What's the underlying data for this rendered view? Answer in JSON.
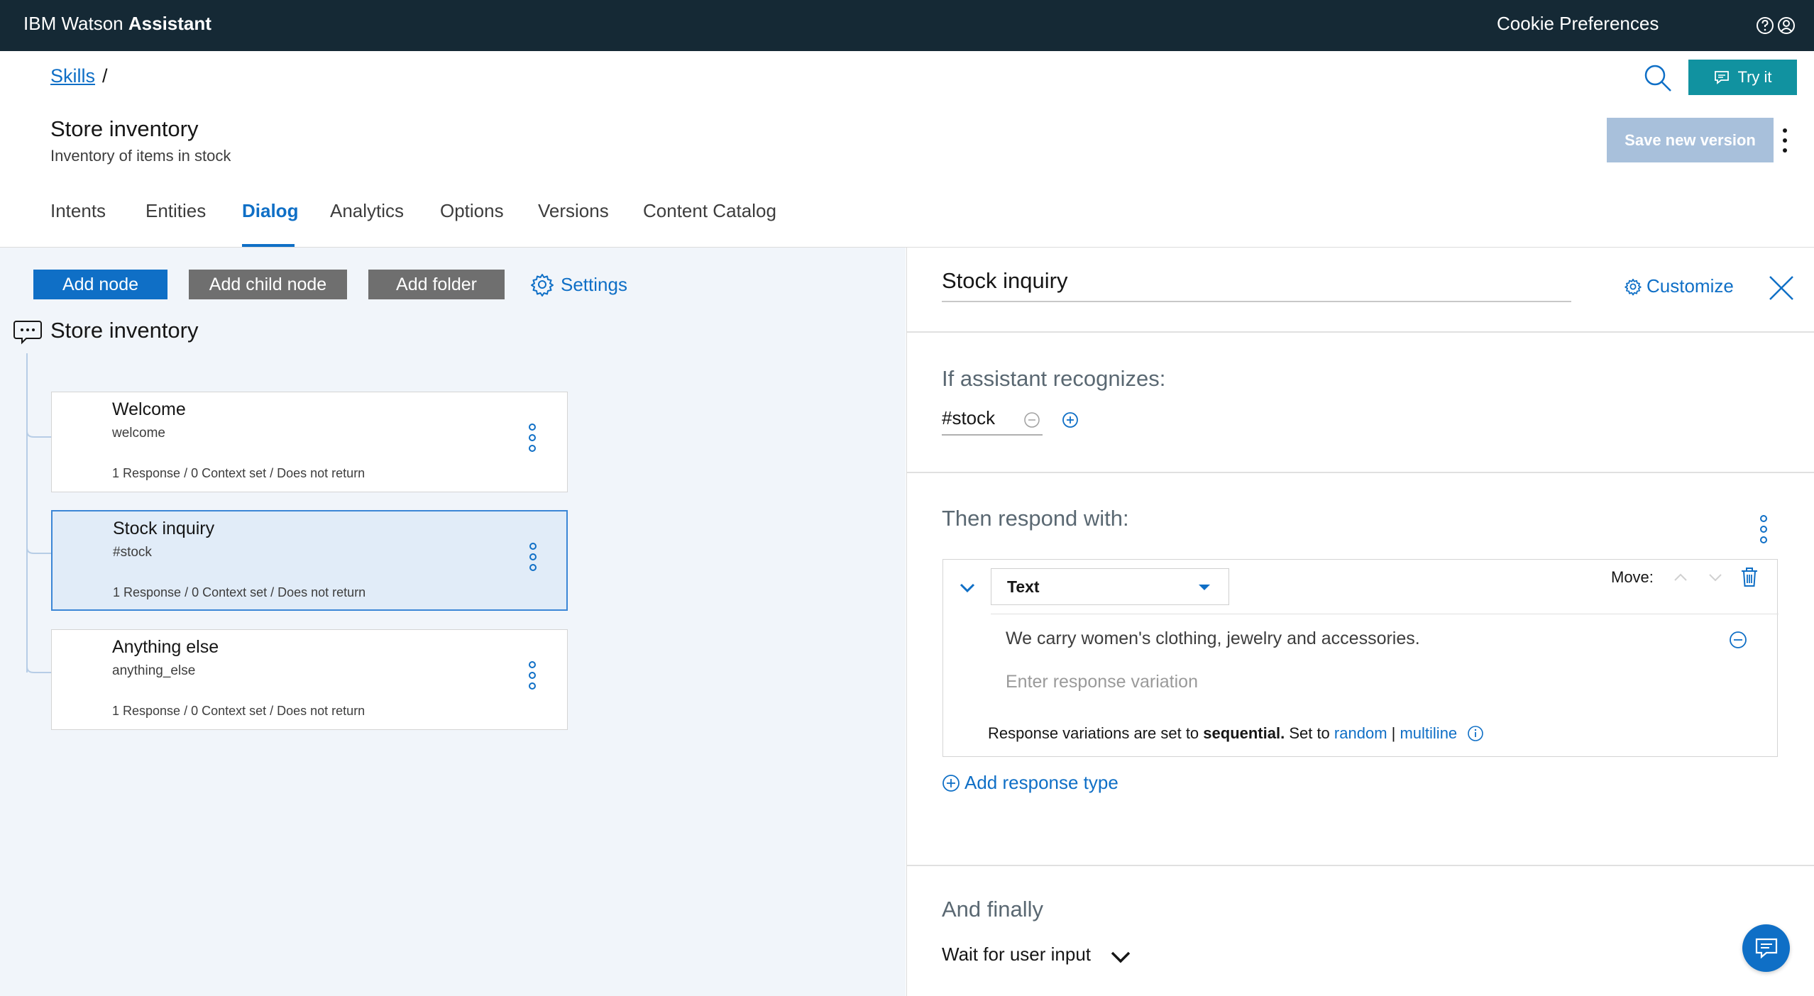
{
  "topbar": {
    "brand_prefix": "IBM Watson",
    "brand_name": "Assistant",
    "cookie_label": "Cookie Preferences",
    "icons": [
      "help-icon",
      "user-avatar-icon"
    ]
  },
  "header": {
    "breadcrumb_link": "Skills",
    "breadcrumb_sep": "/",
    "title": "Store inventory",
    "description": "Inventory of items in stock",
    "try_label": "Try it",
    "save_label": "Save new version"
  },
  "tabs": [
    {
      "label": "Intents"
    },
    {
      "label": "Entities"
    },
    {
      "label": "Dialog",
      "active": true
    },
    {
      "label": "Analytics"
    },
    {
      "label": "Options"
    },
    {
      "label": "Versions"
    },
    {
      "label": "Content Catalog"
    }
  ],
  "toolbar": {
    "add_node": "Add node",
    "add_child": "Add child node",
    "add_folder": "Add folder",
    "settings": "Settings"
  },
  "tree": {
    "root_label": "Store inventory",
    "nodes": [
      {
        "title": "Welcome",
        "condition": "welcome",
        "meta": "1 Response / 0 Context set / Does not return"
      },
      {
        "title": "Stock inquiry",
        "condition": "#stock",
        "meta": "1 Response / 0 Context set / Does not return",
        "selected": true
      },
      {
        "title": "Anything else",
        "condition": "anything_else",
        "meta": "1 Response / 0 Context set / Does not return"
      }
    ]
  },
  "editor": {
    "node_name": "Stock inquiry",
    "customize_label": "Customize",
    "recognizes_title": "If assistant recognizes:",
    "condition_value": "#stock",
    "respond_title": "Then respond with:",
    "response_type": "Text",
    "move_label": "Move:",
    "variation_1": "We carry women's clothing, jewelry and accessories.",
    "variation_placeholder": "Enter response variation",
    "note_prefix": "Response variations are set to ",
    "note_mode": "sequential.",
    "note_set_to": " Set to ",
    "note_random": "random",
    "note_sep": " | ",
    "note_multiline": "multiline",
    "add_response_label": "Add response type",
    "finally_title": "And finally",
    "finally_value": "Wait for user input"
  },
  "colors": {
    "topbar": "#152935",
    "accent": "#0f6fc6",
    "try_button": "#1192a0",
    "save_disabled": "#a8c0db",
    "secondary_button": "#6f6f6f",
    "left_panel_bg": "#f1f5fa"
  }
}
